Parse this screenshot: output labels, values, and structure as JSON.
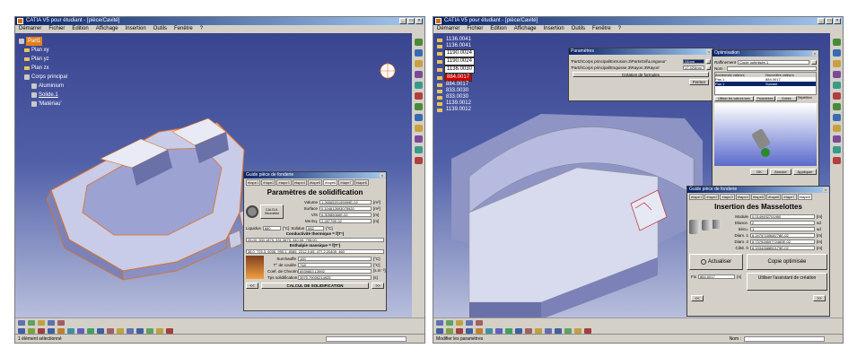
{
  "left_window": {
    "title": "CATIA V5 pour étudiant - [pièce/Cavité]",
    "menu": [
      "Démarrer",
      "Fichier",
      "Edition",
      "Affichage",
      "Insertion",
      "Outils",
      "Fenêtre",
      "?"
    ],
    "tree": [
      {
        "label": "Part1"
      },
      {
        "label": "Plan xy"
      },
      {
        "label": "Plan yz"
      },
      {
        "label": "Plan zx"
      },
      {
        "label": "Corps principal"
      },
      {
        "label": "Aluminium"
      },
      {
        "label": "Solide.1"
      },
      {
        "label": "'Matériau'"
      }
    ],
    "status_text": "1 élément sélectionné",
    "dialog": {
      "title": "Guide pièce de fonderie",
      "tabs": [
        "étape1",
        "étape2",
        "étape3",
        "étape4",
        "étape5",
        "étape6",
        "étape7",
        "étape8"
      ],
      "active_tab": 5,
      "heading": "Paramètres de solidification",
      "calc_button": "CALCUL Géométrie",
      "rows": [
        {
          "label": "Volume",
          "value": "1.2656520195999E-02",
          "unit": "[m³]"
        },
        {
          "label": "Surface",
          "value": "0.104612693075920",
          "unit": "[m²]"
        },
        {
          "label": "V/S",
          "value": "6.30985066E-02",
          "unit": "[m]"
        },
        {
          "label": "Ms Eq.",
          "value": "2.28779E-02",
          "unit": "[m]"
        }
      ],
      "liquidus_label": "Liquidus",
      "liquidus_value": "660",
      "solidus_label": "Solidus",
      "solidus_value": "552",
      "temp_unit": "[°C]",
      "conductivity_label": "Conductivité thermique = f(T°)",
      "conductivity_values": "25.00, 300.1875, 331.3875, 340.00, 795.00,",
      "enthalpy_label": "Enthalpie massique = f(T°)",
      "enthalpy_values": "38.0, 725.3, 6006, 995.1, 8085, 2212.0.65, 477.2.20405. 460",
      "lower_rows": [
        {
          "label": "Surchauffe",
          "value": "100",
          "unit": "[°C]"
        },
        {
          "label": "T° de coulée",
          "value": "748",
          "unit": "[°C]"
        },
        {
          "label": "Coef. de Chvorinoff",
          "value": "6939853.13992",
          "unit": "[s.m⁻²]"
        },
        {
          "label": "Tps solidification ≈",
          "value": "3975.79030214925",
          "unit": "[s]"
        }
      ],
      "calc_solid_button": "CALCUL DE SOLIDIFICATION",
      "prev": "<<",
      "next": ">>"
    }
  },
  "right_window": {
    "title": "CATIA V5 pour étudiant - [pièce/Cavité]",
    "menu": [
      "Démarrer",
      "Fichier",
      "Edition",
      "Affichage",
      "Insertion",
      "Outils",
      "Fenêtre",
      "?"
    ],
    "nodes": [
      "1136.0041",
      "1136.0041",
      "1190.0024",
      "1190.0024",
      "1136.0030",
      "884.0017",
      "884.0017",
      "833.0030",
      "833.0030",
      "1139.0012",
      "1139.0012"
    ],
    "status_text": "Modifier les paramètres",
    "status_label": "Nom :",
    "param_dialog": {
      "title": "Paramètres",
      "rows": [
        {
          "label": "'Part2\\Corps principal\\Extrusion.3\\PartsGril\\Longueur'",
          "value": "24mm"
        },
        {
          "label": "'Part2\\Corps principal\\Esquisse.3\\Rayon.3\\Rayon'",
          "value": "17.424mm"
        }
      ],
      "create_label": "Création de formules",
      "close": "Fermer"
    },
    "optim_dialog": {
      "title": "Optimisation",
      "select_label": "Raffinement",
      "select_value": "Copie optimisée.1",
      "name_label": "Nom :",
      "col1": "Anciennes valeurs",
      "col2": "Nouvelles valeurs",
      "rows": [
        {
          "a": "Pas 1",
          "b": "884.0017"
        },
        {
          "a": "Pas 1",
          "b": "Suivant"
        }
      ],
      "buttons": [
        "Utiliser les valeurs lues",
        "Paramètres",
        "Entrée",
        "Répétition"
      ],
      "ok": "OK",
      "cancel": "Annuler",
      "apply": "Appliquer"
    },
    "riser_dialog": {
      "title": "Guide pièce de fonderie",
      "tabs": [
        "étape1",
        "étape2",
        "étape3",
        "étape4",
        "étape5",
        "étape6",
        "étape7",
        "étape8"
      ],
      "active_tab": 7,
      "heading": "Insertion des Masselottes",
      "rows": [
        {
          "label": "Module",
          "value": "0.0149492701990",
          "unit": "[m]"
        },
        {
          "label": "Elance.",
          "value": "2",
          "unit": "sd"
        },
        {
          "label": "Sécu.",
          "value": "1",
          "unit": "sd"
        },
        {
          "label": "Diam. 1",
          "value": "6.2475715508778E-02",
          "unit": "[m]"
        },
        {
          "label": "Diam. 2",
          "value": "5.73792859772460E-02",
          "unit": "[m]"
        },
        {
          "label": "Côté. h",
          "value": "6.1534268892179E-02",
          "unit": "[m]"
        }
      ],
      "refresh": "Actualiser",
      "fix_label": "Fix",
      "fix_value": "884.0017",
      "s_label": "[s]",
      "copy_button": "Copie optimisée",
      "assistant_button": "Utiliser l'assistant de création",
      "prev": "<<",
      "next": ">>"
    }
  },
  "colors": {
    "accent": "#0a246a",
    "viewport_top": "#3a4590",
    "viewport_bottom": "#b8bedc",
    "highlight": "#e08020"
  }
}
